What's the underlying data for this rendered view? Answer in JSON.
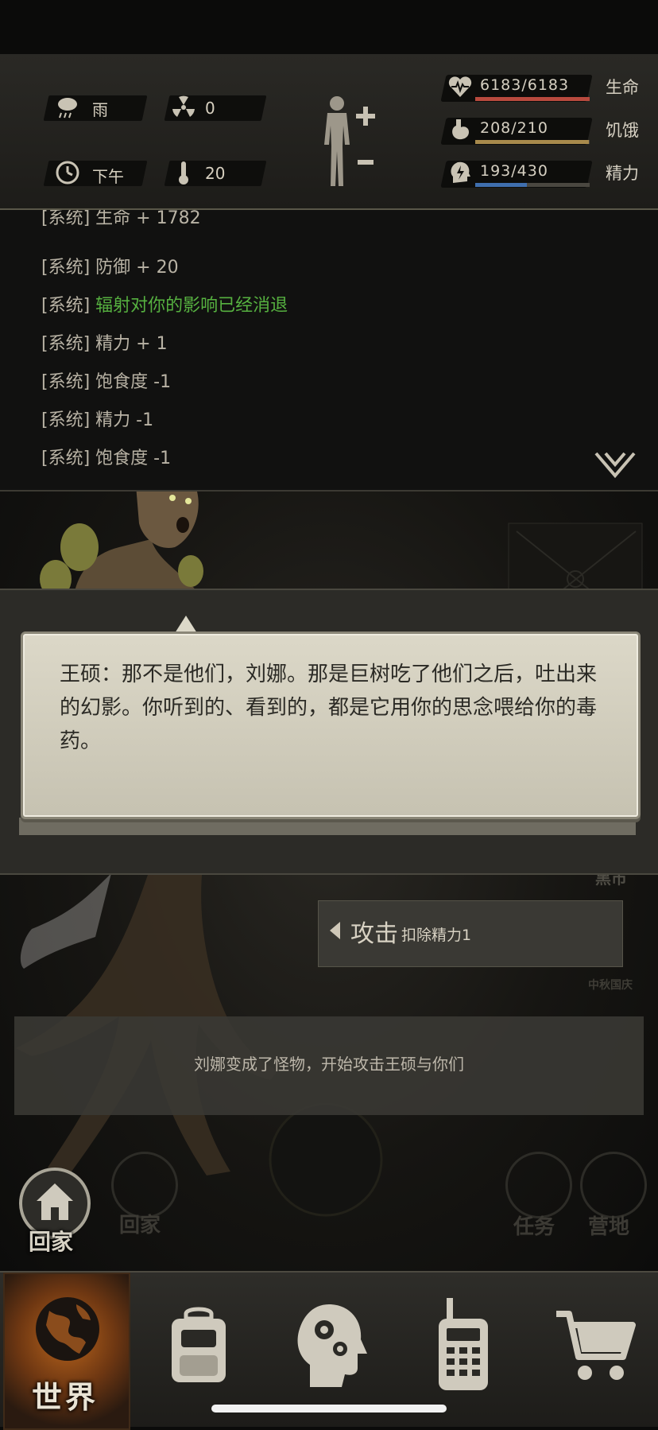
{
  "status": {
    "weather": "雨",
    "radiation": "0",
    "time_of_day": "下午",
    "temperature": "20",
    "health": {
      "value": "6183/6183",
      "label": "生命",
      "fraction": 1.0,
      "color": "#b84a3e"
    },
    "hunger": {
      "value": "208/210",
      "label": "饥饿",
      "fraction": 0.99,
      "color": "#a88a4c"
    },
    "energy": {
      "value": "193/430",
      "label": "精力",
      "fraction": 0.45,
      "color": "#3f6fae"
    }
  },
  "log": [
    {
      "tag": "[系统]",
      "msg": "生命 + 1782",
      "color": "default"
    },
    {
      "tag": "[系统]",
      "msg": "防御 + 20",
      "color": "default"
    },
    {
      "tag": "[系统]",
      "msg": "辐射对你的影响已经消退",
      "color": "green"
    },
    {
      "tag": "[系统]",
      "msg": "精力 + 1",
      "color": "default"
    },
    {
      "tag": "[系统]",
      "msg": "饱食度 -1",
      "color": "default"
    },
    {
      "tag": "[系统]",
      "msg": "精力 -1",
      "color": "default"
    },
    {
      "tag": "[系统]",
      "msg": "饱食度 -1",
      "color": "default"
    }
  ],
  "dialog": {
    "text": "王硕：那不是他们，刘娜。那是巨树吃了他们之后，吐出来的幻影。你听到的、看到的，都是它用你的思念喂给你的毒药。"
  },
  "action": {
    "label": "攻击",
    "cost": "扣除精力1"
  },
  "narration": "刘娜变成了怪物，开始攻击王硕与你们",
  "background_labels": {
    "black_market": "黑市",
    "festival": "中秋国庆",
    "home": "回家",
    "task": "任务",
    "camp": "营地"
  },
  "home_button": {
    "label": "回家"
  },
  "nav": {
    "world": "世界",
    "items": [
      "backpack-icon",
      "brain-icon",
      "walkie-talkie-icon",
      "cart-icon"
    ]
  }
}
